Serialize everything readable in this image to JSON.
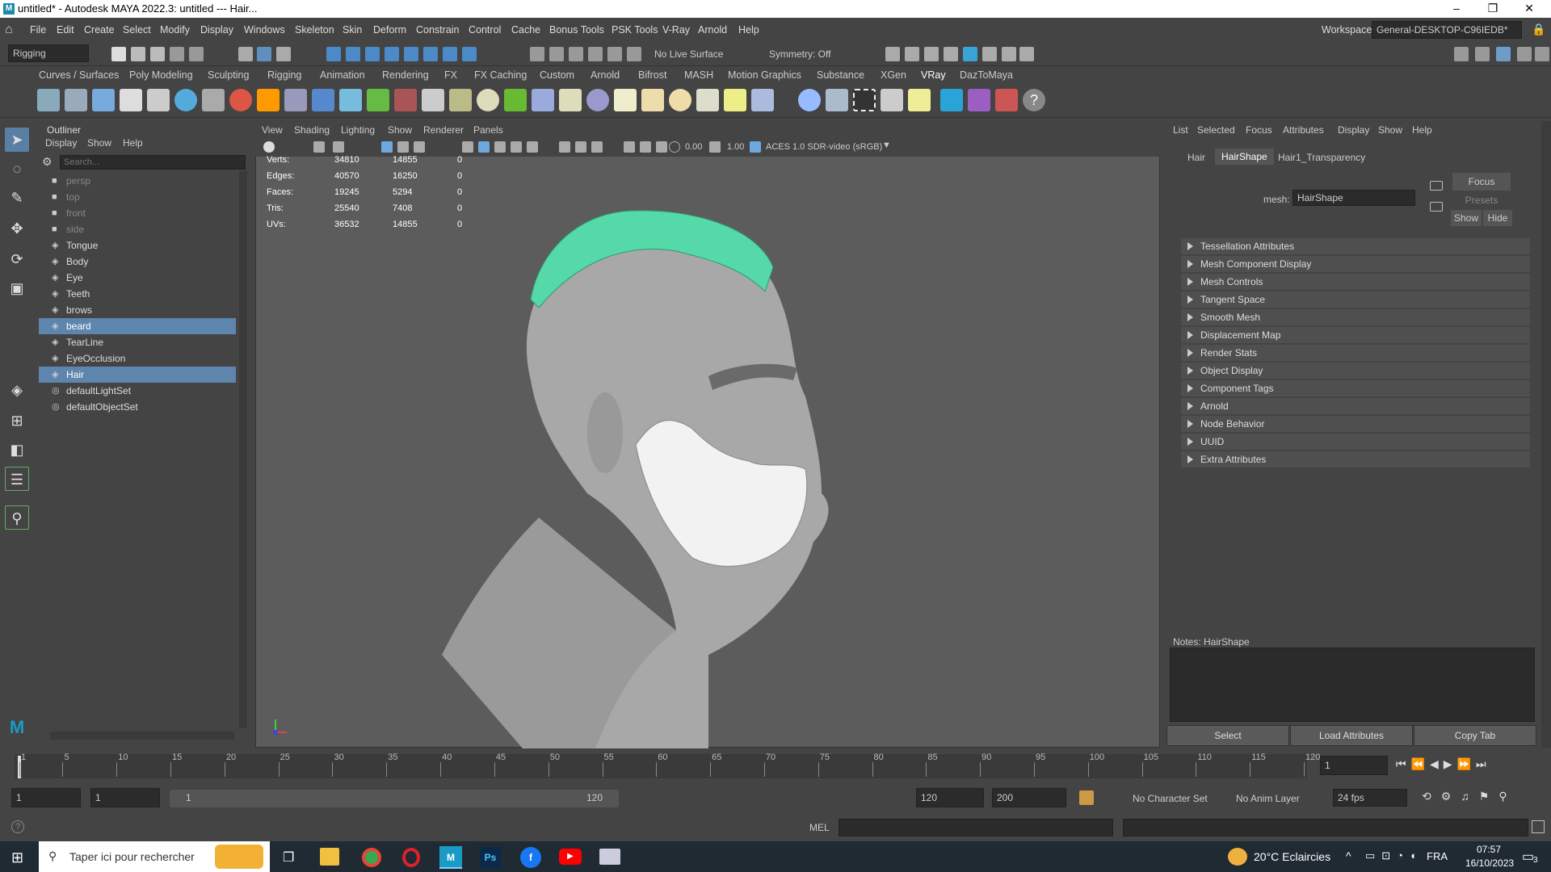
{
  "window": {
    "title": "untitled* - Autodesk MAYA 2022.3: untitled  ---  Hair...",
    "min": "–",
    "restore": "❐",
    "close": "✕"
  },
  "menus": [
    "File",
    "Edit",
    "Create",
    "Select",
    "Modify",
    "Display",
    "Windows",
    "Skeleton",
    "Skin",
    "Deform",
    "Constrain",
    "Control",
    "Cache",
    "Bonus Tools",
    "PSK Tools",
    "V-Ray",
    "Arnold",
    "Help"
  ],
  "workspace": {
    "label": "Workspace:",
    "value": "General-DESKTOP-C96IEDB*"
  },
  "status": {
    "mode": "Rigging",
    "live_surface": "No Live Surface",
    "symmetry": "Symmetry: Off"
  },
  "shelf_tabs": [
    "Curves / Surfaces",
    "Poly Modeling",
    "Sculpting",
    "Rigging",
    "Animation",
    "Rendering",
    "FX",
    "FX Caching",
    "Custom",
    "Arnold",
    "Bifrost",
    "MASH",
    "Motion Graphics",
    "Substance",
    "XGen",
    "VRay",
    "DazToMaya"
  ],
  "outliner": {
    "title": "Outliner",
    "menu": [
      "Display",
      "Show",
      "Help"
    ],
    "search_placeholder": "Search...",
    "items": [
      {
        "label": "persp",
        "dim": true,
        "icon": "camera"
      },
      {
        "label": "top",
        "dim": true,
        "icon": "camera"
      },
      {
        "label": "front",
        "dim": true,
        "icon": "camera"
      },
      {
        "label": "side",
        "dim": true,
        "icon": "camera"
      },
      {
        "label": "Tongue",
        "icon": "mesh"
      },
      {
        "label": "Body",
        "icon": "mesh"
      },
      {
        "label": "Eye",
        "icon": "mesh"
      },
      {
        "label": "Teeth",
        "icon": "mesh"
      },
      {
        "label": "brows",
        "icon": "mesh"
      },
      {
        "label": "beard",
        "selected": true,
        "icon": "mesh"
      },
      {
        "label": "TearLine",
        "icon": "mesh"
      },
      {
        "label": "EyeOcclusion",
        "icon": "mesh"
      },
      {
        "label": "Hair",
        "selected": true,
        "icon": "mesh"
      },
      {
        "label": "defaultLightSet",
        "icon": "set"
      },
      {
        "label": "defaultObjectSet",
        "icon": "set"
      }
    ]
  },
  "viewport": {
    "menu": [
      "View",
      "Shading",
      "Lighting",
      "Show",
      "Renderer",
      "Panels"
    ],
    "exposure": "0.00",
    "gamma": "1.00",
    "colorspace": "ACES 1.0 SDR-video (sRGB)",
    "hud": [
      {
        "label": "Verts:",
        "a": "34810",
        "b": "14855",
        "c": "0"
      },
      {
        "label": "Edges:",
        "a": "40570",
        "b": "16250",
        "c": "0"
      },
      {
        "label": "Faces:",
        "a": "19245",
        "b": "5294",
        "c": "0"
      },
      {
        "label": "Tris:",
        "a": "25540",
        "b": "7408",
        "c": "0"
      },
      {
        "label": "UVs:",
        "a": "36532",
        "b": "14855",
        "c": "0"
      }
    ]
  },
  "attr": {
    "menu": [
      "List",
      "Selected",
      "Focus",
      "Attributes",
      "Display",
      "Show",
      "Help"
    ],
    "tabs": [
      "Hair",
      "HairShape",
      "Hair1_Transparency"
    ],
    "mesh_label": "mesh:",
    "mesh_value": "HairShape",
    "focus": "Focus",
    "presets": "Presets",
    "show": "Show",
    "hide": "Hide",
    "sections": [
      "Tessellation Attributes",
      "Mesh Component Display",
      "Mesh Controls",
      "Tangent Space",
      "Smooth Mesh",
      "Displacement Map",
      "Render Stats",
      "Object Display",
      "Component Tags",
      "Arnold",
      "Node Behavior",
      "UUID",
      "Extra Attributes"
    ],
    "notes": "Notes:  HairShape",
    "buttons": [
      "Select",
      "Load Attributes",
      "Copy Tab"
    ]
  },
  "timeline": {
    "ticks": [
      "1",
      "5",
      "10",
      "15",
      "20",
      "25",
      "30",
      "35",
      "40",
      "45",
      "50",
      "55",
      "60",
      "65",
      "70",
      "75",
      "80",
      "85",
      "90",
      "95",
      "100",
      "105",
      "110",
      "115",
      "120"
    ],
    "current": "1"
  },
  "range": {
    "start": "1",
    "start2": "1",
    "slider_start": "1",
    "slider_end": "120",
    "end": "120",
    "end2": "200",
    "character": "No Character Set",
    "anim_layer": "No Anim Layer",
    "fps": "24 fps"
  },
  "cmd": {
    "lang": "MEL"
  },
  "taskbar": {
    "search": "Taper ici pour rechercher",
    "weather": "20°C  Eclaircies",
    "lang": "FRA",
    "time": "07:57",
    "date": "16/10/2023",
    "notif": "3"
  }
}
